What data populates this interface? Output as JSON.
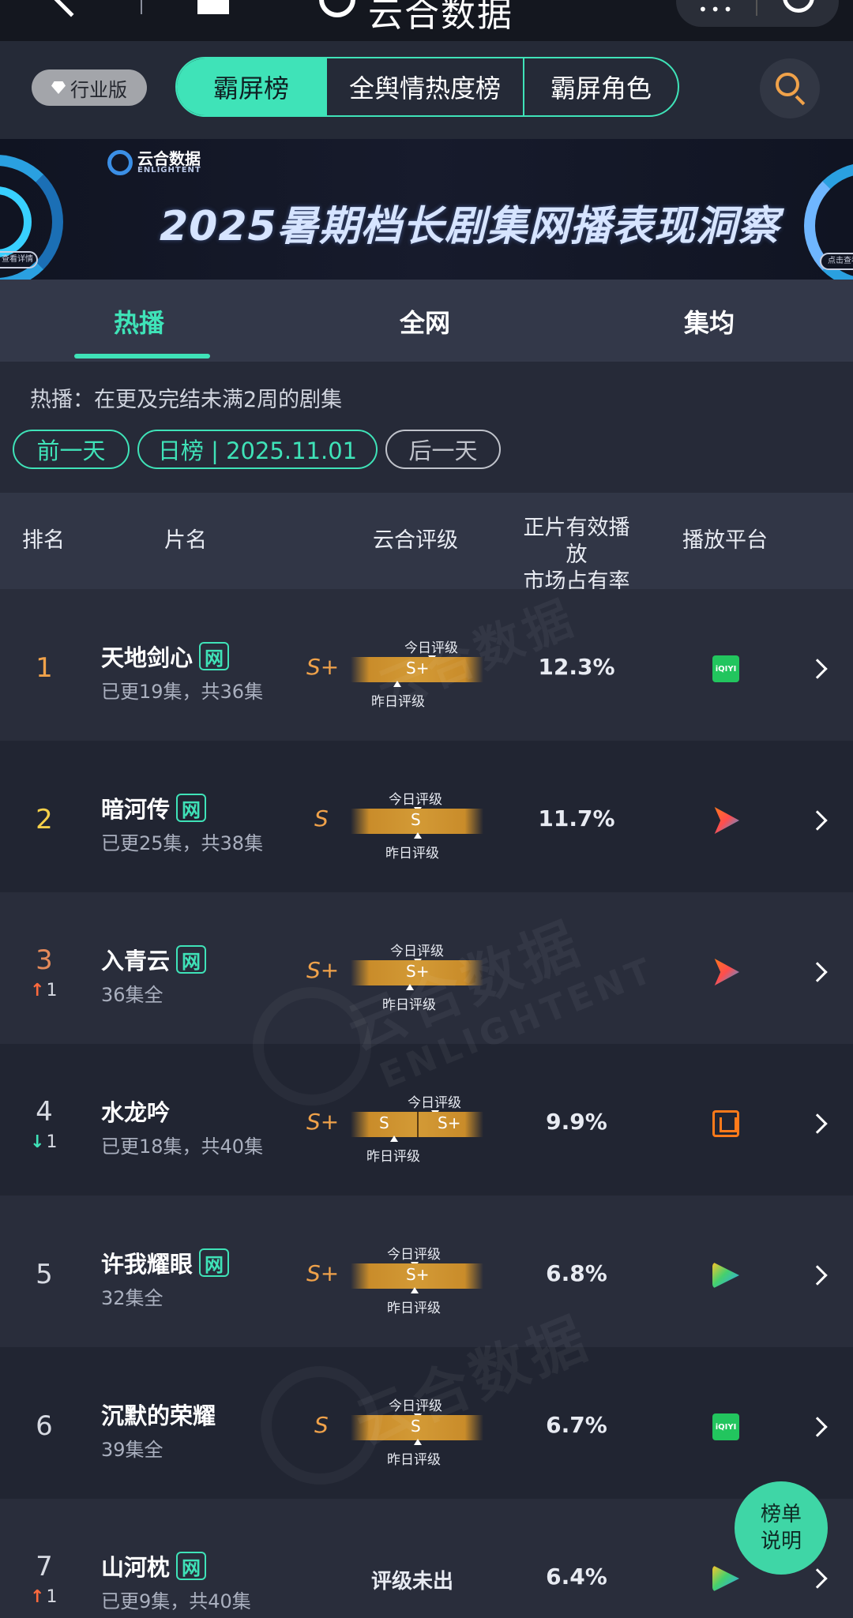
{
  "app": {
    "title": "云合数据",
    "capsule_dots": "•••"
  },
  "header": {
    "edition_label": "行业版",
    "tabs": [
      "霸屏榜",
      "全舆情热度榜",
      "霸屏角色"
    ],
    "active_tab": 0
  },
  "banner": {
    "brand_cn": "云合数据",
    "brand_en": "ENLIGHTENT",
    "title": "2025暑期档长剧集网播表现洞察",
    "left_pill": "查看详情",
    "right_pill": "点击查看"
  },
  "subtabs": [
    "热播",
    "全网",
    "集均"
  ],
  "info": {
    "description": "热播：在更及完结未满2周的剧集",
    "prev_day": "前一天",
    "date_label": "日榜 | 2025.11.01",
    "next_day": "后一天"
  },
  "columns": {
    "rank": "排名",
    "title": "片名",
    "rating": "云合评级",
    "share_line1": "正片有效播放",
    "share_line2": "市场占有率",
    "platform": "播放平台"
  },
  "rating_labels": {
    "today": "今日评级",
    "yesterday": "昨日评级",
    "none": "评级未出"
  },
  "rows": [
    {
      "rank": "1",
      "title": "天地剑心",
      "web": "网",
      "episodes": "已更19集，共36集",
      "grade": "S+",
      "bar": "S+",
      "share": "12.3%",
      "platform": "iqiyi",
      "trend": "",
      "trend_dir": ""
    },
    {
      "rank": "2",
      "title": "暗河传",
      "web": "网",
      "episodes": "已更25集，共38集",
      "grade": "S",
      "bar": "S",
      "share": "11.7%",
      "platform": "youku",
      "trend": "",
      "trend_dir": ""
    },
    {
      "rank": "3",
      "title": "入青云",
      "web": "网",
      "episodes": "36集全",
      "grade": "S+",
      "bar": "S+",
      "share": "",
      "platform": "youku",
      "trend": "1",
      "trend_dir": "up"
    },
    {
      "rank": "4",
      "title": "水龙吟",
      "web": "",
      "episodes": "已更18集，共40集",
      "grade": "S+",
      "bar_left": "S",
      "bar_right": "S+",
      "share": "9.9%",
      "platform": "mgtv",
      "trend": "1",
      "trend_dir": "down"
    },
    {
      "rank": "5",
      "title": "许我耀眼",
      "web": "网",
      "episodes": "32集全",
      "grade": "S+",
      "bar": "S+",
      "share": "6.8%",
      "platform": "tencent",
      "trend": "",
      "trend_dir": ""
    },
    {
      "rank": "6",
      "title": "沉默的荣耀",
      "web": "",
      "episodes": "39集全",
      "grade": "S",
      "bar": "S",
      "share": "6.7%",
      "platform": "iqiyi",
      "trend": "",
      "trend_dir": ""
    },
    {
      "rank": "7",
      "title": "山河枕",
      "web": "网",
      "episodes": "已更9集，共40集",
      "grade": "",
      "bar": "",
      "share": "6.4%",
      "platform": "tencent",
      "trend": "1",
      "trend_dir": "up"
    }
  ],
  "platform_iqiyi_text": "iQIYI",
  "watermark": "云合数据",
  "watermark_en": "ENLIGHTENT",
  "fab": {
    "line1": "榜单",
    "line2": "说明"
  },
  "colors": {
    "accent": "#3fe3b8",
    "grade": "#f0a24a",
    "rank_top": "#f0a24a",
    "up": "#ff6a3d",
    "down": "#3fe3b8"
  }
}
